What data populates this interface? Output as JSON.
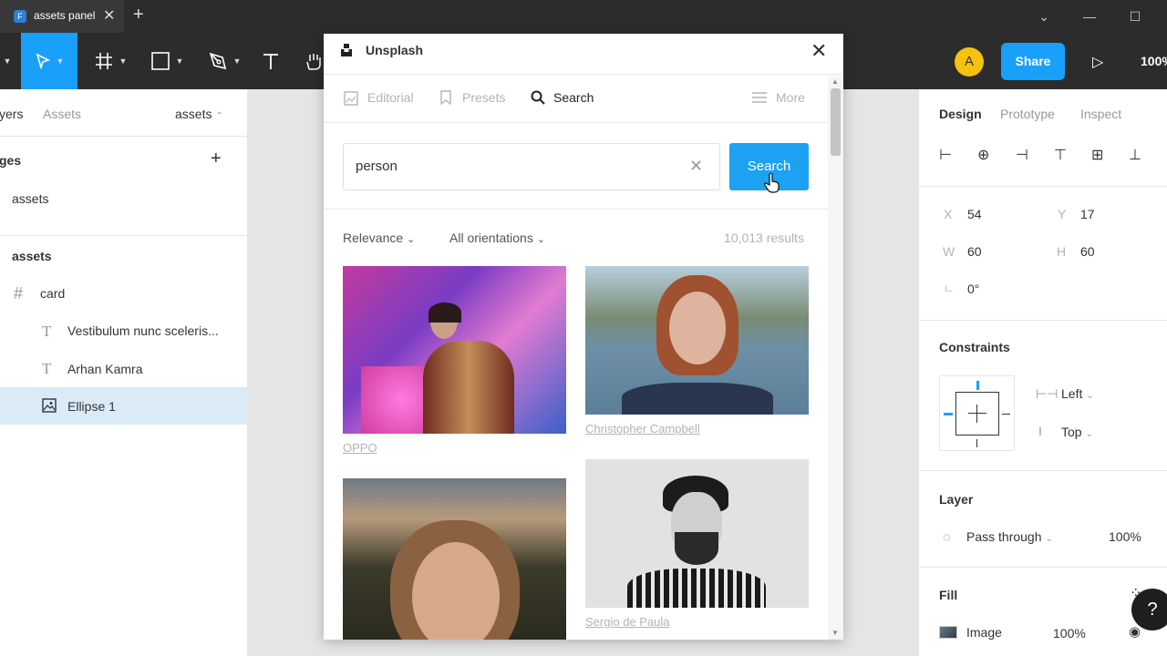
{
  "browser": {
    "tab_title": "assets panel",
    "close_glyph": "✕",
    "add_glyph": "+"
  },
  "toolbar": {
    "avatar_initial": "A",
    "share_label": "Share",
    "zoom": "100%"
  },
  "left_panel": {
    "tabs": [
      "yers",
      "Assets"
    ],
    "page_dropdown": "assets",
    "pages_header": "ges",
    "pages": [
      "assets"
    ],
    "layers_header": "assets",
    "layers": [
      {
        "icon": "frame-icon",
        "label": "card"
      },
      {
        "icon": "text-icon",
        "label": "Vestibulum nunc sceleris..."
      },
      {
        "icon": "text-icon",
        "label": "Arhan Kamra"
      },
      {
        "icon": "image-icon",
        "label": "Ellipse 1"
      }
    ]
  },
  "modal": {
    "title": "Unsplash",
    "tabs": {
      "editorial": "Editorial",
      "presets": "Presets",
      "search": "Search",
      "more": "More"
    },
    "search_value": "person",
    "search_button": "Search",
    "filter_relevance": "Relevance",
    "filter_orientation": "All orientations",
    "results_count": "10,013 results",
    "photos": [
      {
        "credit": "OPPO"
      },
      {
        "credit": "Christopher Campbell"
      },
      {
        "credit": ""
      },
      {
        "credit": "Sergio de Paula"
      }
    ]
  },
  "right_panel": {
    "tabs": {
      "design": "Design",
      "prototype": "Prototype",
      "inspect": "Inspect"
    },
    "x_label": "X",
    "x_value": "54",
    "y_label": "Y",
    "y_value": "17",
    "w_label": "W",
    "w_value": "60",
    "h_label": "H",
    "h_value": "60",
    "rotation_value": "0°",
    "constraints_header": "Constraints",
    "constraint_h": "Left",
    "constraint_v": "Top",
    "layer_header": "Layer",
    "blend_mode": "Pass through",
    "layer_opacity": "100%",
    "fill_header": "Fill",
    "fill_type": "Image",
    "fill_opacity": "100%"
  },
  "help_glyph": "?"
}
